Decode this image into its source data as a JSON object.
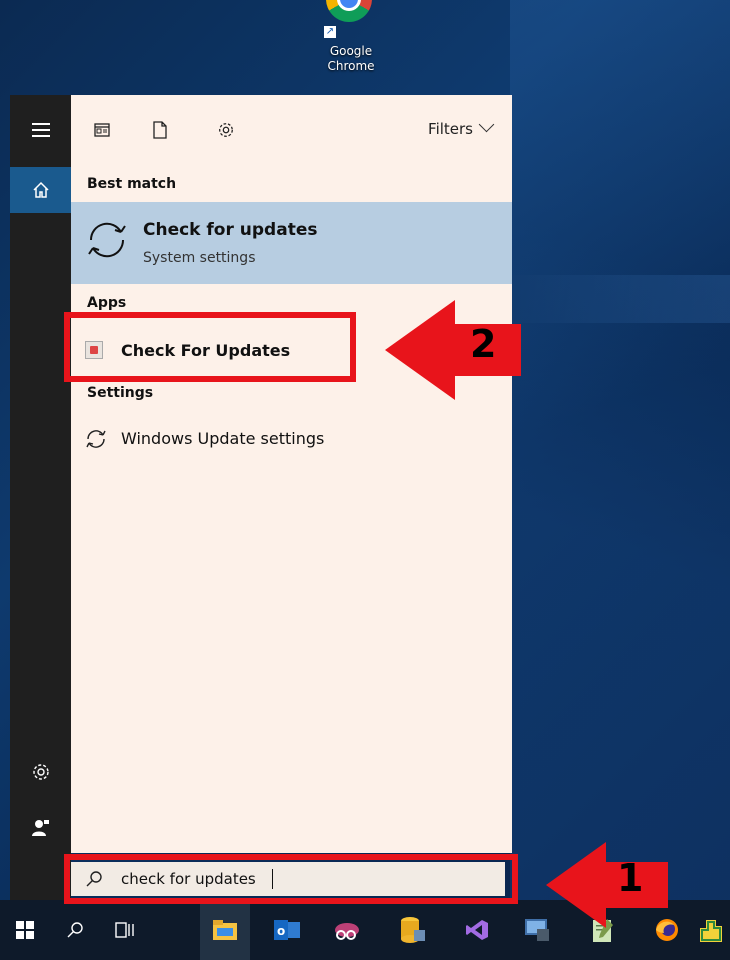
{
  "desktop": {
    "shortcut_label": "Google Chrome"
  },
  "start_menu": {
    "rail": {
      "items": [
        "menu-icon",
        "home-icon",
        "settings-icon",
        "user-icon"
      ]
    },
    "toolbar": {
      "icons": [
        "documents-icon",
        "file-icon",
        "gear-icon"
      ],
      "filters_label": "Filters"
    },
    "best_match": {
      "section_label": "Best match",
      "title": "Check for updates",
      "subtitle": "System settings"
    },
    "apps": {
      "section_label": "Apps",
      "item_label": "Check For Updates"
    },
    "settings": {
      "section_label": "Settings",
      "item_label": "Windows Update settings"
    }
  },
  "search": {
    "value": "check for updates"
  },
  "taskbar": {
    "items": [
      "windows-start-icon",
      "search-icon",
      "task-view-icon",
      "file-explorer-icon",
      "outlook-icon",
      "snipping-tool-icon",
      "sql-server-icon",
      "visual-studio-icon",
      "remote-desktop-icon",
      "notepad-icon",
      "firefox-icon",
      "green-app-icon"
    ]
  },
  "annotations": {
    "step1": "1",
    "step2": "2",
    "highlight_color": "#e8141b"
  }
}
